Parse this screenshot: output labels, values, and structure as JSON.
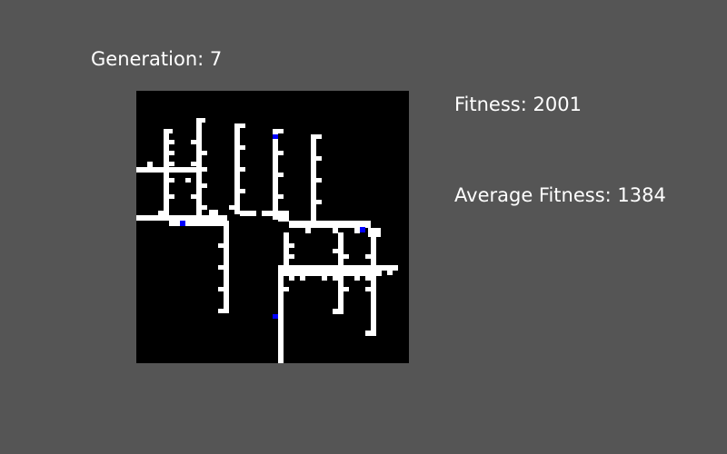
{
  "stats": {
    "generation_label": "Generation: 7",
    "fitness_label": "Fitness: 2001",
    "average_fitness_label": "Average Fitness: 1384"
  },
  "grid": {
    "cells_per_side": 50,
    "background_color": "#000000",
    "wall_color": "#ffffff",
    "agent_color": "#0000ff"
  },
  "colors": {
    "page_background": "#555555",
    "text": "#ffffff"
  }
}
